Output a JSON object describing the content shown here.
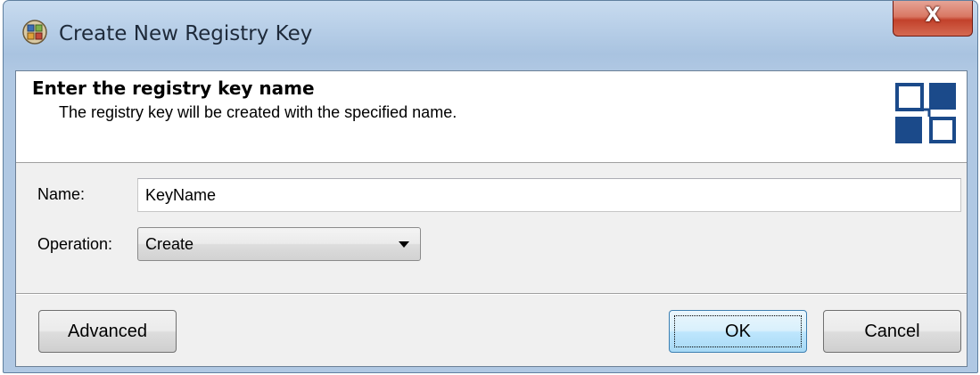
{
  "window": {
    "title": "Create New Registry Key",
    "close_label": "X"
  },
  "header": {
    "heading": "Enter the registry key name",
    "subheading": "The registry key will be created with the specified name."
  },
  "form": {
    "name_label": "Name:",
    "name_value": "KeyName",
    "operation_label": "Operation:",
    "operation_value": "Create"
  },
  "buttons": {
    "advanced": "Advanced",
    "ok": "OK",
    "cancel": "Cancel"
  },
  "icons": {
    "app": "registry-app-icon",
    "header": "registry-keys-icon",
    "close": "close-icon",
    "dropdown": "chevron-down-icon"
  },
  "colors": {
    "header_icon": "#1b4a8a",
    "close_button": "#c94b35"
  }
}
